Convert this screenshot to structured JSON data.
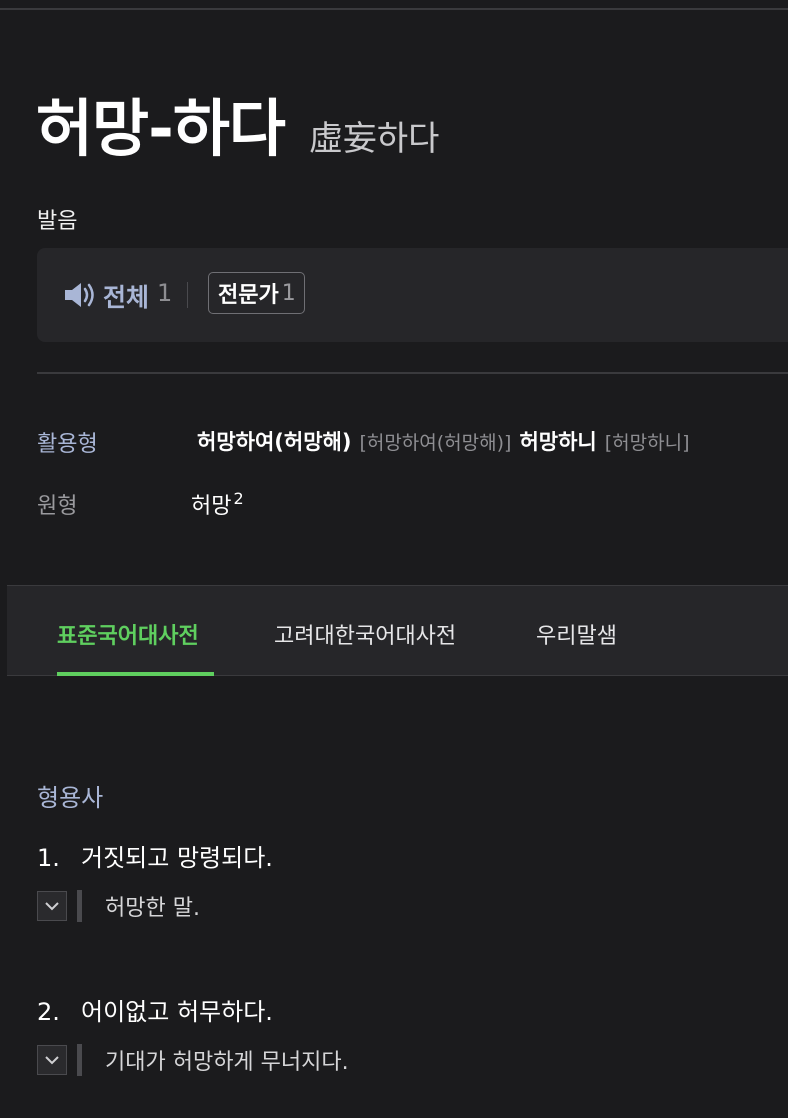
{
  "entry": {
    "word": "허망-하다",
    "hanja": "虛妄하다"
  },
  "pronunciation": {
    "section_label": "발음",
    "speaker_icon": "speaker-icon",
    "all_label": "전체",
    "all_count": "1",
    "expert_label": "전문가",
    "expert_count": "1"
  },
  "conjugation": {
    "label": "활용형",
    "forms": [
      {
        "form": "허망하여(허망해)",
        "pron": "[허망하여(허망해)]"
      },
      {
        "form": "허망하니",
        "pron": "[허망하니]"
      }
    ]
  },
  "original_form": {
    "label": "원형",
    "word": "허망",
    "superscript": "2"
  },
  "dictionary_tabs": [
    {
      "label": "표준국어대사전",
      "active": true
    },
    {
      "label": "고려대한국어대사전",
      "active": false
    },
    {
      "label": "우리말샘",
      "active": false
    }
  ],
  "definitions": {
    "part_of_speech": "형용사",
    "senses": [
      {
        "number": "1.",
        "text": "거짓되고 망령되다.",
        "example": "허망한 말."
      },
      {
        "number": "2.",
        "text": "어이없고 허무하다.",
        "example": "기대가 허망하게 무너지다."
      }
    ]
  },
  "colors": {
    "background": "#1b1b1d",
    "panel": "#262629",
    "accent_blue": "#a9b6d6",
    "accent_green": "#5fcf5f"
  }
}
